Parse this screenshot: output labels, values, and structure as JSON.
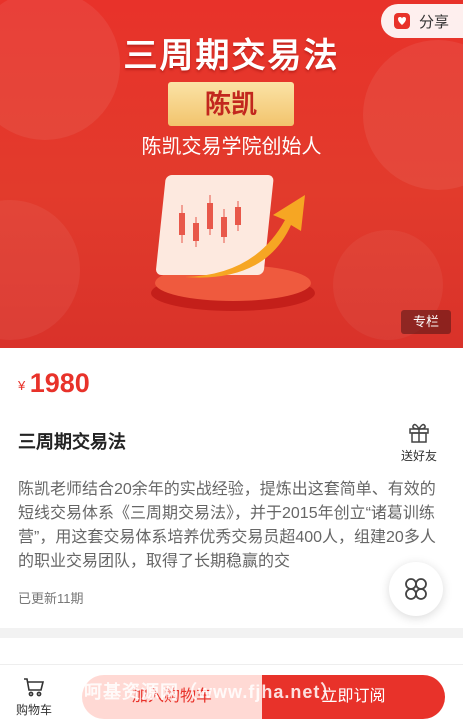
{
  "banner": {
    "title": "三周期交易法",
    "author_name": "陈凯",
    "author_subtitle": "陈凯交易学院创始人",
    "tag": "专栏"
  },
  "share": {
    "label": "分享",
    "icon": "share-icon"
  },
  "product": {
    "currency": "¥",
    "price": "1980",
    "title": "三周期交易法",
    "gift_label": "送好友",
    "description": "陈凯老师结合20余年的实战经验，提炼出这套简单、有效的短线交易体系《三周期交易法》，并于2015年创立“诸葛训练营”，用这套交易体系培养优秀交易员超400人，组建20多人的职业交易团队，取得了长期稳赢的交",
    "updated": "已更新11期"
  },
  "bottom_bar": {
    "cart_label": "购物车",
    "add_to_cart": "加入购物车",
    "subscribe": "立即订阅",
    "watermark": "呵基资源网（www.fjha.net）"
  },
  "colors": {
    "accent": "#e8322a",
    "gold": "#f2c46d"
  }
}
